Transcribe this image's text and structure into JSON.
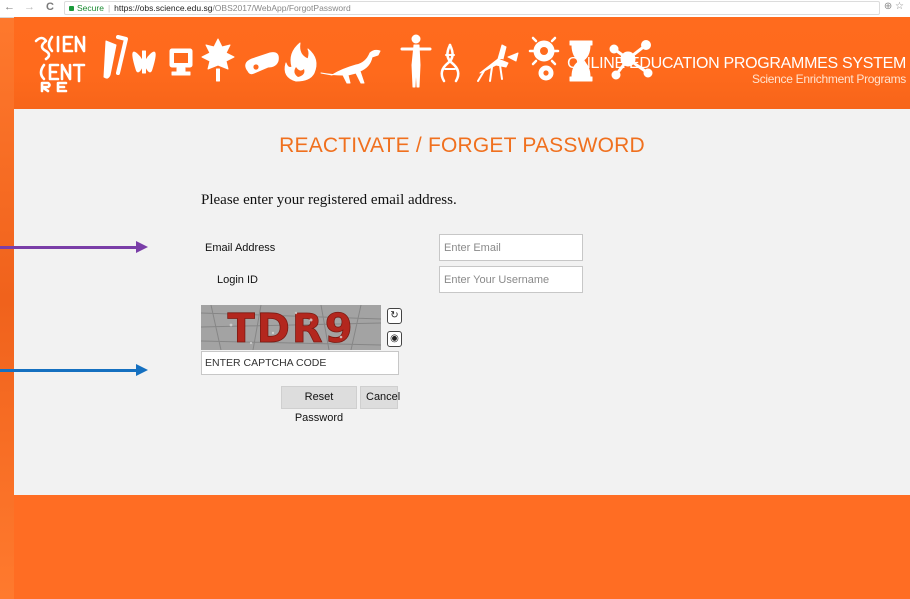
{
  "browser": {
    "back": "←",
    "forward": "→",
    "reload": "C",
    "secure_label": "Secure",
    "separator": "|",
    "url_host": "https://obs.science.edu.sg",
    "url_path": "/OBS2017/WebApp/ForgotPassword",
    "zoom_icon": "⊕",
    "star_icon": "☆"
  },
  "header": {
    "logo_line1": "SCIENCE",
    "logo_line2": "CENTRE",
    "title": "ONLINE EDUCATION PROGRAMMES SYSTEM",
    "subtitle": "Science Enrichment Programs",
    "icons": [
      "test-tube-icon",
      "butterfly-icon",
      "computer-icon",
      "leaf-icon",
      "pill-icon",
      "fire-icon",
      "dinosaur-icon",
      "human-figure-icon",
      "dna-icon",
      "mosquito-icon",
      "gear-icon",
      "hourglass-icon",
      "molecule-icon"
    ]
  },
  "form": {
    "title": "REACTIVATE / FORGET PASSWORD",
    "instructions": "Please enter your registered email address.",
    "email_label": "Email Address",
    "email_placeholder": "Enter Email",
    "login_label": "Login ID",
    "login_placeholder": "Enter Your Username",
    "captcha_text": "TDR9",
    "captcha_placeholder": "ENTER CAPTCHA CODE",
    "refresh_icon": "↻",
    "audio_icon": "◉",
    "reset_button": "Reset Password",
    "cancel_button": "Cancel"
  },
  "colors": {
    "brand_orange": "#ff6a1f",
    "title_orange": "#f0701e",
    "arrow_purple": "#7a3ea8",
    "arrow_blue": "#1570c0"
  }
}
